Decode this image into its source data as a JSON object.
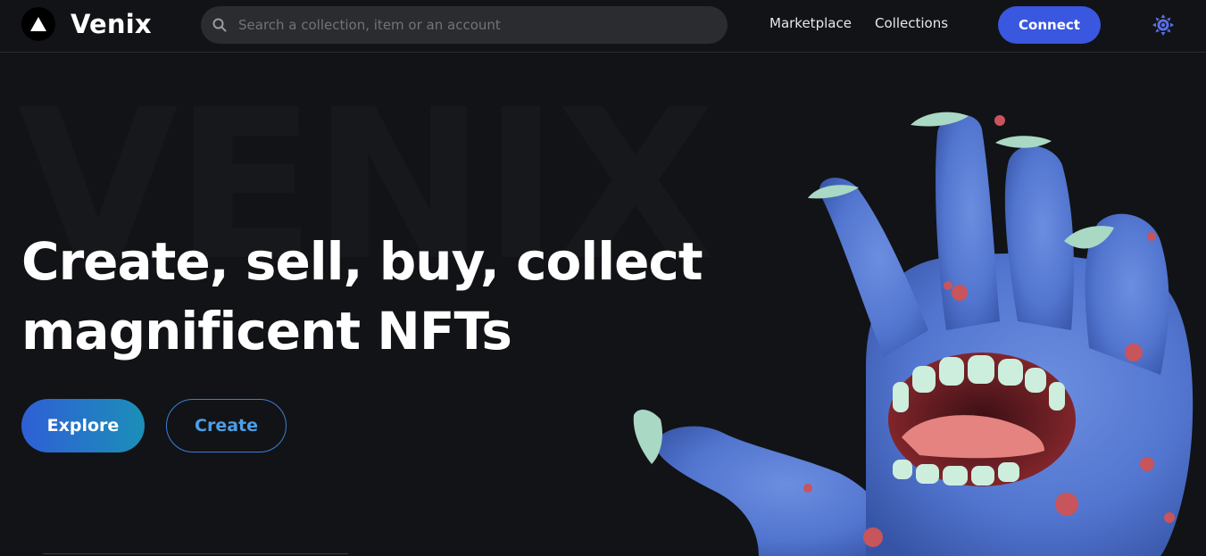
{
  "header": {
    "brand": "Venix",
    "search_placeholder": "Search a collection, item or an account",
    "nav": {
      "marketplace": "Marketplace",
      "collections": "Collections"
    },
    "connect_label": "Connect",
    "icons": {
      "logo": "triangle-logo-icon",
      "search": "search-icon",
      "theme": "sun-icon"
    }
  },
  "hero": {
    "background_word": "VENIX",
    "title_line1": "Create, sell, buy, collect",
    "title_line2": "magnificent NFTs",
    "explore_label": "Explore",
    "create_label": "Create",
    "illustration": "blue-monster-hand-illustration"
  },
  "colors": {
    "background": "#121316",
    "accent": "#3a57e0",
    "explore_gradient_start": "#2f5fd6",
    "explore_gradient_end": "#1b8fb8",
    "create_outline": "#3b7fd6",
    "theme_icon": "#5b6ee8"
  }
}
